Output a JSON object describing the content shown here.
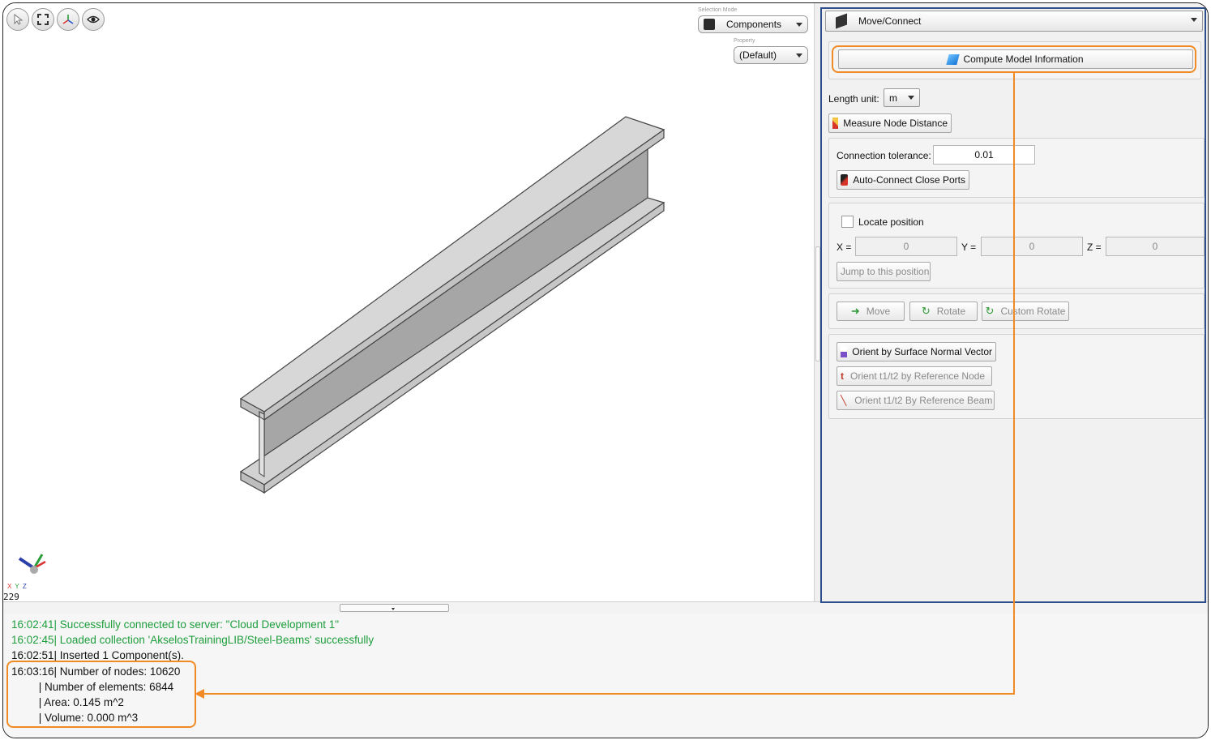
{
  "viewport": {
    "toolbar": [
      {
        "icon": "cursor-icon"
      },
      {
        "icon": "fit-view-icon"
      },
      {
        "icon": "axes-icon"
      },
      {
        "icon": "eye-icon"
      }
    ],
    "selection_mode": {
      "label": "Selection Mode",
      "value": "Components"
    },
    "property": {
      "label": "Property",
      "value": "(Default)"
    },
    "axis_labels": {
      "x": "X",
      "y": "Y",
      "z": "Z"
    },
    "node_count": "229"
  },
  "panel": {
    "title": "Move/Connect",
    "compute_button": "Compute Model Information",
    "length_unit": {
      "label": "Length unit:",
      "value": "m"
    },
    "measure_button": "Measure Node Distance",
    "tolerance": {
      "label": "Connection tolerance:",
      "value": "0.01"
    },
    "auto_connect_button": "Auto-Connect Close Ports",
    "locate": {
      "checkbox_label": "Locate position",
      "x_label": "X =",
      "x_value": "0",
      "y_label": "Y =",
      "y_value": "0",
      "z_label": "Z =",
      "z_value": "0",
      "jump_button": "Jump to this position"
    },
    "transform": {
      "move": "Move",
      "rotate": "Rotate",
      "custom_rotate": "Custom Rotate"
    },
    "orient": {
      "surface_normal": "Orient by Surface Normal Vector",
      "ref_node": "Orient t1/t2 by Reference Node",
      "ref_beam": "Orient t1/t2 By Reference Beam"
    }
  },
  "console": {
    "lines": [
      {
        "text": "16:02:41| Successfully connected to server: \"Cloud Development 1\"",
        "style": "green"
      },
      {
        "text": "16:02:45| Loaded collection 'AkselosTrainingLIB/Steel-Beams' successfully",
        "style": "green"
      },
      {
        "text": "16:02:51| Inserted 1 Component(s).",
        "style": "normal"
      },
      {
        "text": "16:03:16| Number of nodes: 10620",
        "style": "normal"
      },
      {
        "text": "         | Number of elements: 6844",
        "style": "normal"
      },
      {
        "text": "         | Area: 0.145 m^2",
        "style": "normal"
      },
      {
        "text": "         | Volume: 0.000 m^3",
        "style": "normal"
      }
    ]
  },
  "colors": {
    "highlight_orange": "#f08a24",
    "highlight_blue": "#2c4f8c",
    "log_green": "#1e9e3c"
  }
}
